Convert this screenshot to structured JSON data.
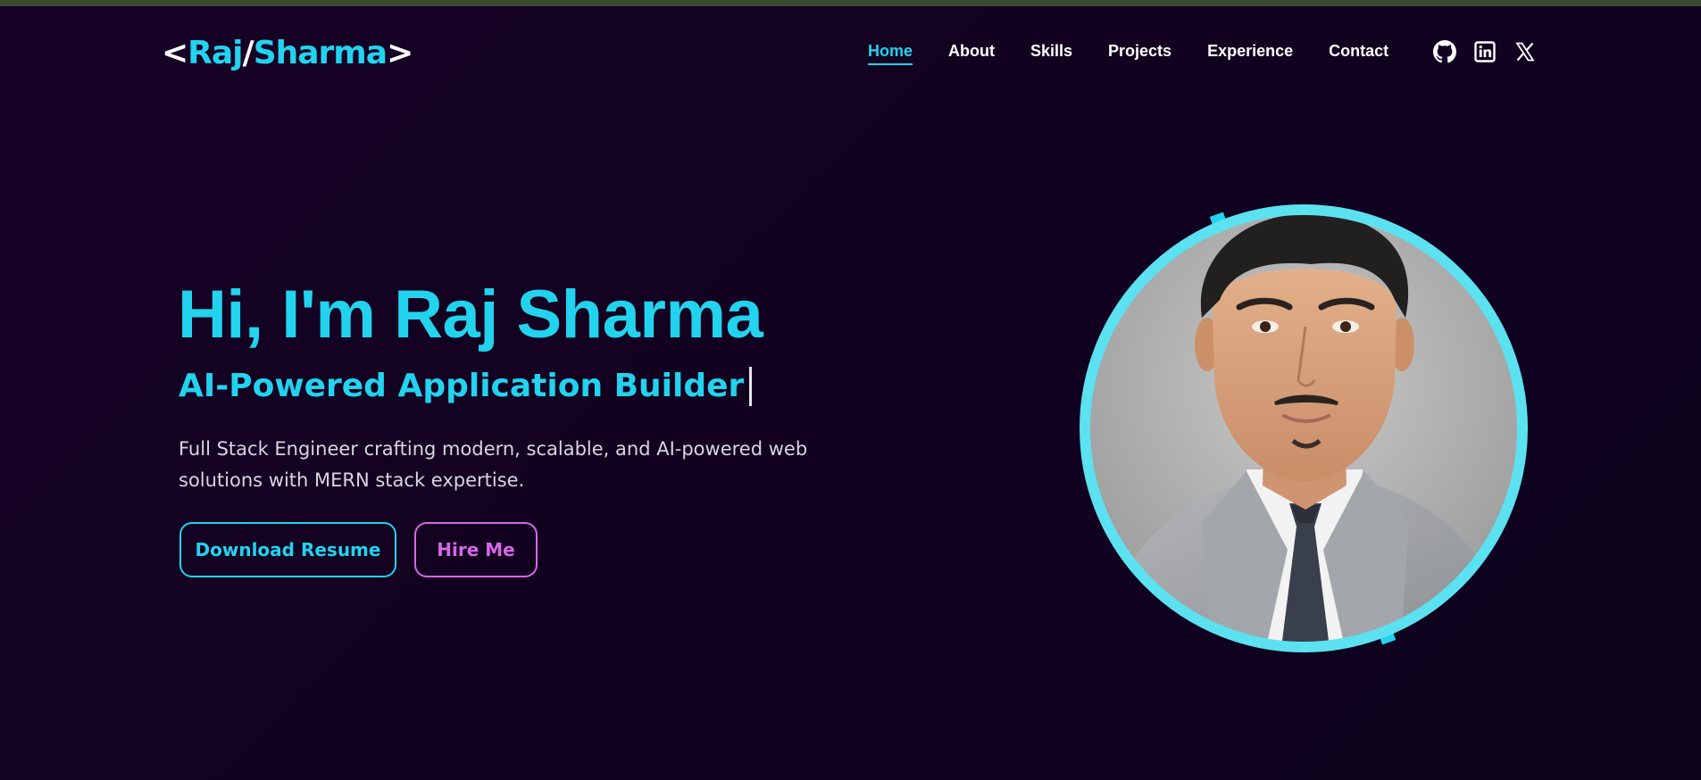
{
  "header": {
    "logo": {
      "open": "<",
      "first": "Raj",
      "slash": "/",
      "last": "Sharma",
      "close": ">"
    },
    "nav": [
      {
        "label": "Home",
        "active": true
      },
      {
        "label": "About",
        "active": false
      },
      {
        "label": "Skills",
        "active": false
      },
      {
        "label": "Projects",
        "active": false
      },
      {
        "label": "Experience",
        "active": false
      },
      {
        "label": "Contact",
        "active": false
      }
    ],
    "socials": [
      {
        "icon": "github-icon"
      },
      {
        "icon": "linkedin-icon"
      },
      {
        "icon": "x-icon"
      }
    ]
  },
  "hero": {
    "title": "Hi, I'm Raj Sharma",
    "role": "AI-Powered Application Builder",
    "description": "Full Stack Engineer crafting modern, scalable, and AI-powered web solutions with MERN stack expertise.",
    "buttons": {
      "resume": "Download Resume",
      "hire": "Hire Me"
    },
    "portrait_icon": "profile-photo"
  },
  "colors": {
    "accent": "#22d3ee",
    "secondary": "#d468e6",
    "background": "#12021f",
    "text": "#ffffff"
  }
}
